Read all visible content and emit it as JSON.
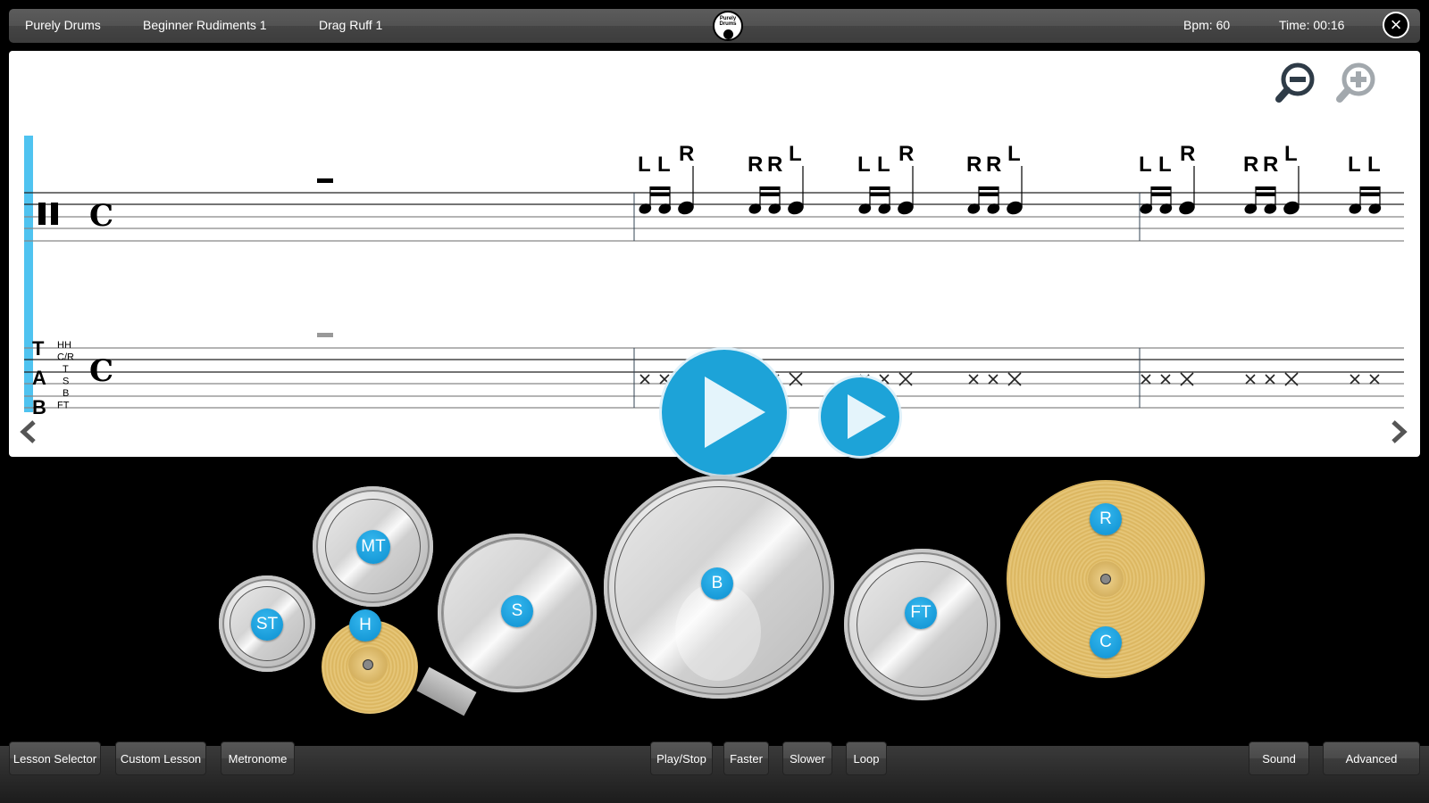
{
  "header": {
    "app_name": "Purely Drums",
    "lesson_group": "Beginner Rudiments 1",
    "lesson_name": "Drag Ruff 1",
    "logo_line1": "Purely",
    "logo_line2": "Drums",
    "bpm": "Bpm: 60",
    "time": "Time: 00:16",
    "close_icon": "×"
  },
  "score": {
    "zoom_out_icon": "zoom-out-icon",
    "zoom_in_icon": "zoom-in-icon",
    "prev_icon": "chevron-left-icon",
    "next_icon": "chevron-right-icon",
    "accent_color": "#4fc3f0",
    "percussion_clef": "𝄥",
    "time_signature": "C",
    "tab_label": [
      "T",
      "A",
      "B"
    ],
    "tab_lines": [
      "HH",
      "C/R",
      "T",
      "S",
      "B",
      "FT"
    ],
    "sticking": [
      [
        "L",
        "L",
        "R"
      ],
      [
        "R",
        "R",
        "L"
      ],
      [
        "L",
        "L",
        "R"
      ],
      [
        "R",
        "R",
        "L"
      ],
      [
        "L",
        "L",
        "R"
      ],
      [
        "R",
        "R",
        "L"
      ],
      [
        "L",
        "L"
      ]
    ]
  },
  "play": {
    "play_icon": "play-icon",
    "play_slow_icon": "play-icon",
    "color": "#1da3d8"
  },
  "kit": {
    "pads": {
      "small_tom": "ST",
      "mid_tom": "MT",
      "hihat": "H",
      "snare": "S",
      "bass": "B",
      "floor_tom": "FT",
      "ride": "R",
      "crash": "C"
    },
    "pad_color": "#1e9fe0"
  },
  "toolbar": {
    "lesson_selector": "Lesson Selector",
    "custom_lesson": "Custom Lesson",
    "metronome": "Metronome",
    "play_stop": "Play/Stop",
    "faster": "Faster",
    "slower": "Slower",
    "loop": "Loop",
    "sound": "Sound",
    "advanced": "Advanced"
  }
}
